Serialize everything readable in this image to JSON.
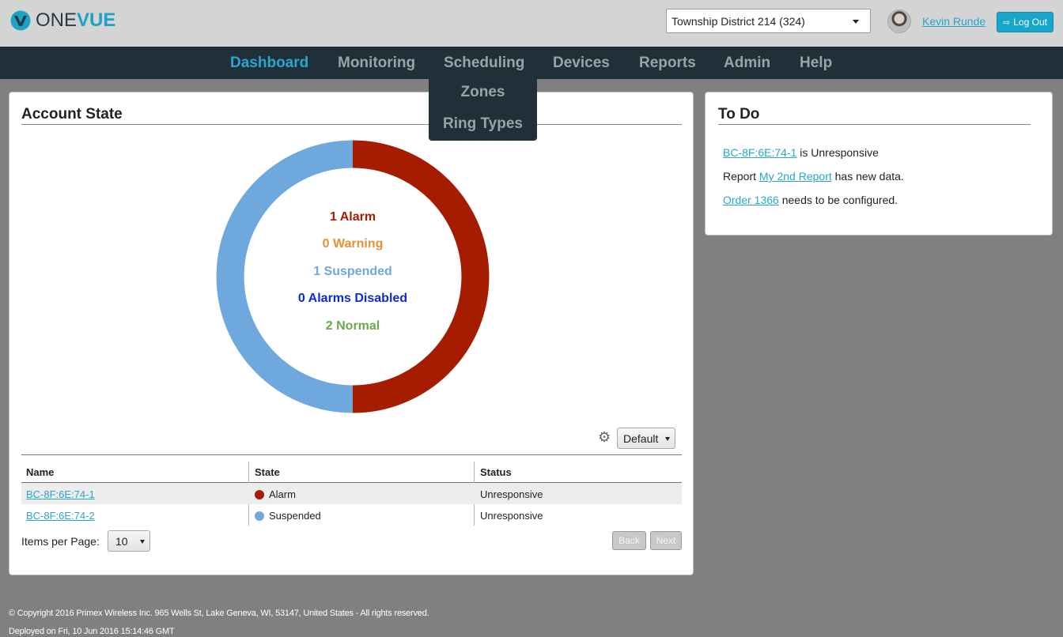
{
  "header": {
    "logo_one": "ONE",
    "logo_vue": "VUE",
    "account_select_value": "Township District 214 (324)",
    "username": "Kevin Runde",
    "logout_label": "Log Out"
  },
  "nav": {
    "items": [
      {
        "label": "Dashboard",
        "active": true
      },
      {
        "label": "Monitoring",
        "active": false
      },
      {
        "label": "Scheduling",
        "active": false
      },
      {
        "label": "Devices",
        "active": false
      },
      {
        "label": "Reports",
        "active": false
      },
      {
        "label": "Admin",
        "active": false
      },
      {
        "label": "Help",
        "active": false
      }
    ],
    "scheduling_dropdown": [
      "Zones",
      "Ring Types"
    ]
  },
  "account_state": {
    "title": "Account State",
    "colors": {
      "alarm": "#a61c00",
      "warning": "#e69138",
      "suspended": "#6fa8dc",
      "alarms_disabled": "#0b2bd6",
      "normal": "#6aa84f"
    },
    "summary": {
      "alarm": "1 Alarm",
      "warning": "0 Warning",
      "suspended": "1 Suspended",
      "alarms_disabled": "0 Alarms Disabled",
      "normal": "2 Normal"
    },
    "donut": [
      {
        "state": "Alarm",
        "count": 1
      },
      {
        "state": "Suspended",
        "count": 1
      }
    ],
    "view_select_value": "Default",
    "table": {
      "columns": [
        "Name",
        "State",
        "Status"
      ],
      "rows": [
        {
          "name": "BC-8F:6E:74-1",
          "state": "Alarm",
          "status": "Unresponsive"
        },
        {
          "name": "BC-8F:6E:74-2",
          "state": "Suspended",
          "status": "Unresponsive"
        }
      ]
    },
    "items_per_page_label": "Items per Page:",
    "items_per_page_value": "10",
    "back_label": "Back",
    "next_label": "Next"
  },
  "todo": {
    "title": "To Do",
    "items": [
      {
        "link": "BC-8F:6E:74-1",
        "text_after": " is Unresponsive"
      },
      {
        "text_before": "Report ",
        "link": "My 2nd Report",
        "text_after": " has new data."
      },
      {
        "link": "Order 1366",
        "text_after": " needs to be configured."
      }
    ]
  },
  "footer": {
    "copyright": "© Copyright 2016 Primex Wireless Inc. 965 Wells St, Lake Geneva, WI, 53147, United States - All rights reserved.",
    "deployed": "Deployed on Fri, 10 Jun 2016 15:14:46 GMT"
  }
}
